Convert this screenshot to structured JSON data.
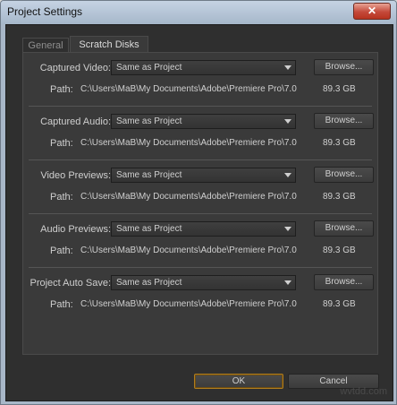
{
  "window": {
    "title": "Project Settings",
    "close_label": "✕"
  },
  "tabs": [
    {
      "label": "General",
      "active": false
    },
    {
      "label": "Scratch Disks",
      "active": true
    }
  ],
  "sections": [
    {
      "label": "Captured Video:",
      "dropdown_value": "Same as Project",
      "browse_label": "Browse...",
      "path_label": "Path:",
      "path": "C:\\Users\\MaB\\My Documents\\Adobe\\Premiere Pro\\7.0",
      "size": "89.3 GB"
    },
    {
      "label": "Captured Audio:",
      "dropdown_value": "Same as Project",
      "browse_label": "Browse...",
      "path_label": "Path:",
      "path": "C:\\Users\\MaB\\My Documents\\Adobe\\Premiere Pro\\7.0",
      "size": "89.3 GB"
    },
    {
      "label": "Video Previews:",
      "dropdown_value": "Same as Project",
      "browse_label": "Browse...",
      "path_label": "Path:",
      "path": "C:\\Users\\MaB\\My Documents\\Adobe\\Premiere Pro\\7.0",
      "size": "89.3 GB"
    },
    {
      "label": "Audio Previews:",
      "dropdown_value": "Same as Project",
      "browse_label": "Browse...",
      "path_label": "Path:",
      "path": "C:\\Users\\MaB\\My Documents\\Adobe\\Premiere Pro\\7.0",
      "size": "89.3 GB"
    },
    {
      "label": "Project Auto Save:",
      "dropdown_value": "Same as Project",
      "browse_label": "Browse...",
      "path_label": "Path:",
      "path": "C:\\Users\\MaB\\My Documents\\Adobe\\Premiere Pro\\7.0",
      "size": "89.3 GB"
    }
  ],
  "footer": {
    "ok_label": "OK",
    "cancel_label": "Cancel"
  },
  "watermark": "wvtdd.com",
  "colors": {
    "dialog_bg": "#2f2f2f",
    "panel_bg": "#3a3a3a",
    "focus_accent": "#b07d1f",
    "title_bar": "#b5c4d6",
    "close_button": "#c4493a"
  }
}
